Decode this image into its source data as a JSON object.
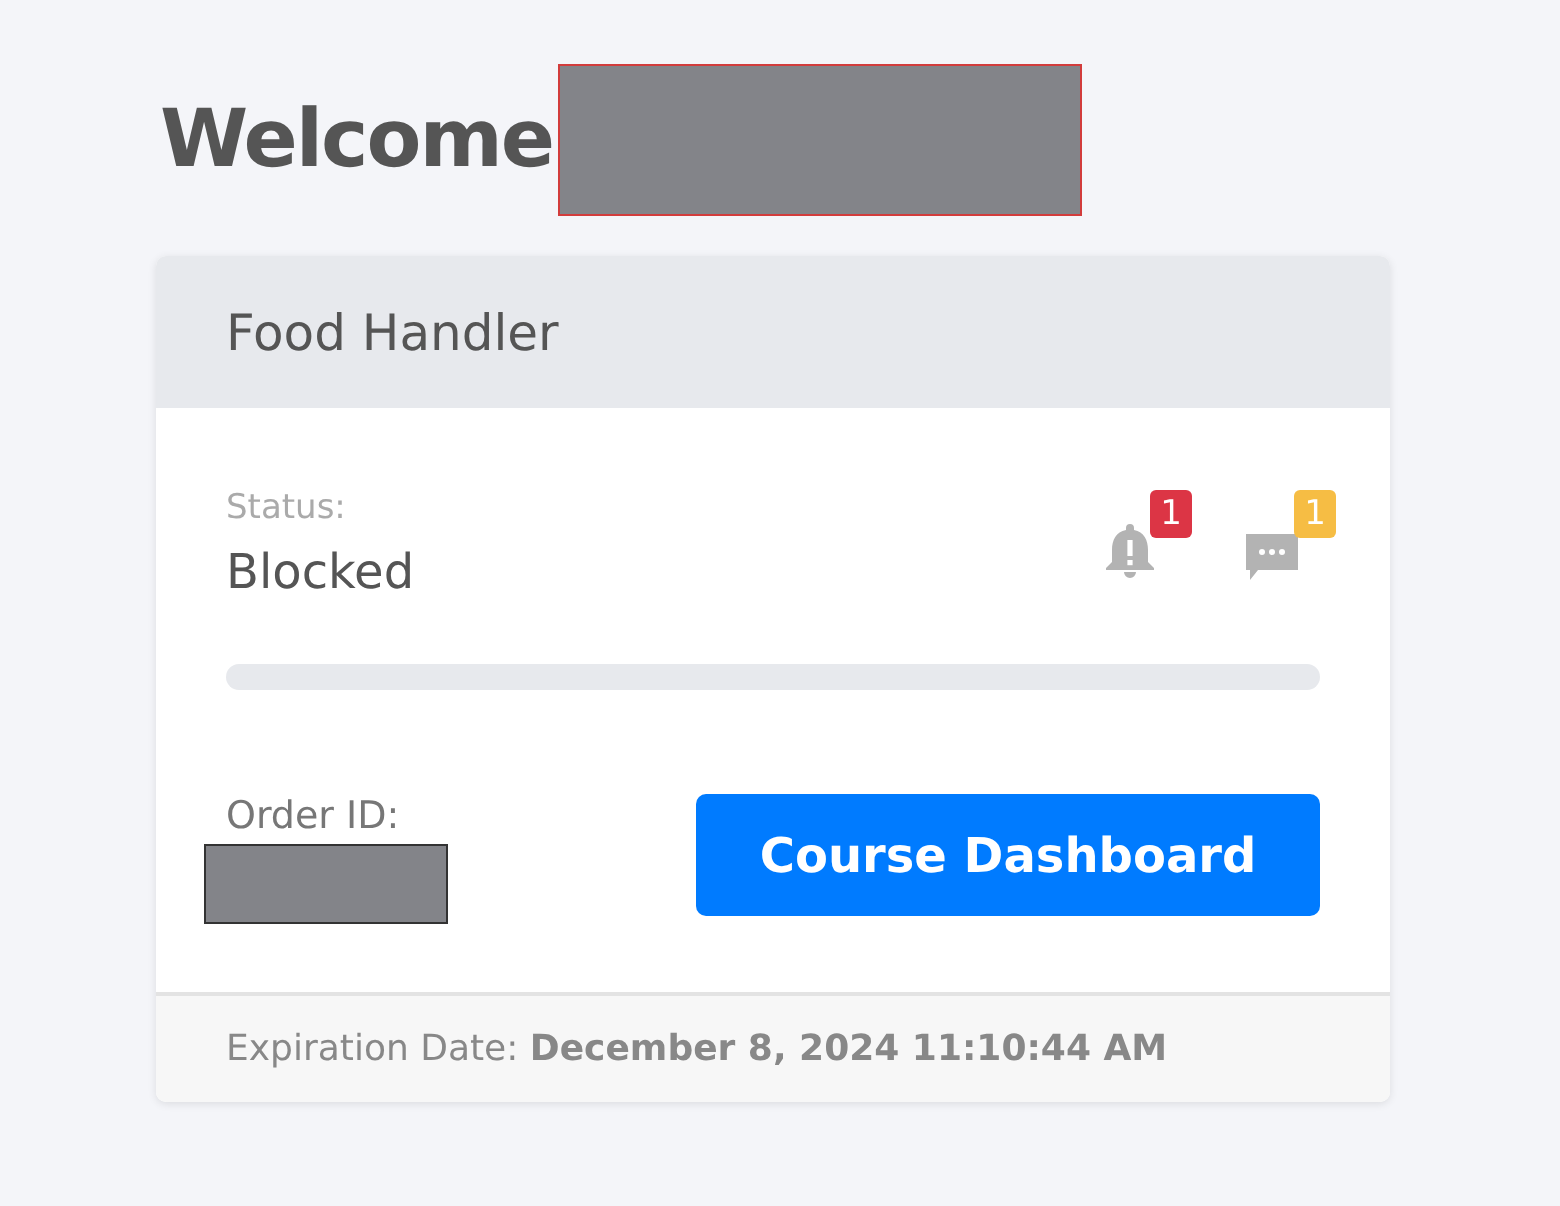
{
  "greeting": "Welcome",
  "card": {
    "title": "Food Handler",
    "status_label": "Status:",
    "status": "Blocked",
    "notifications": [
      {
        "kind": "bell",
        "count": "1",
        "color": "#dc3545"
      },
      {
        "kind": "chat",
        "count": "1",
        "color": "#f6bd44"
      }
    ],
    "order_label": "Order ID:",
    "button": "Course Dashboard",
    "footer": "Expiration Date: **December 8, 2024 11:10:44 AM**"
  }
}
